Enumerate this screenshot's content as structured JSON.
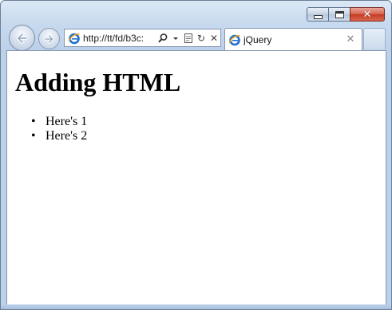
{
  "window": {
    "caption_buttons": {
      "minimize_icon": "minimize-icon",
      "maximize_icon": "maximize-icon",
      "close_icon": "close-icon"
    },
    "close_glyph": "✕"
  },
  "toolbar": {
    "back_icon": "back-arrow-icon",
    "forward_icon": "forward-arrow-icon",
    "address": "http://tt/fd/b3c:",
    "address_tools": [
      "search-icon",
      "dropdown-icon",
      "compatibility-view-icon",
      "refresh-icon",
      "stop-icon"
    ],
    "refresh_glyph": "↻",
    "stop_glyph": "✕"
  },
  "tabs": [
    {
      "label": "jQuery",
      "icon": "ie-page-icon",
      "close_glyph": "✕",
      "active": true
    }
  ],
  "page": {
    "heading": "Adding HTML",
    "items": [
      "Here's 1",
      "Here's 2"
    ],
    "bullet": "•"
  },
  "colors": {
    "frame": "#c7d9ee",
    "close_button": "#c43a23",
    "ie_blue": "#1e6fd1",
    "ie_gold": "#e8a317"
  }
}
